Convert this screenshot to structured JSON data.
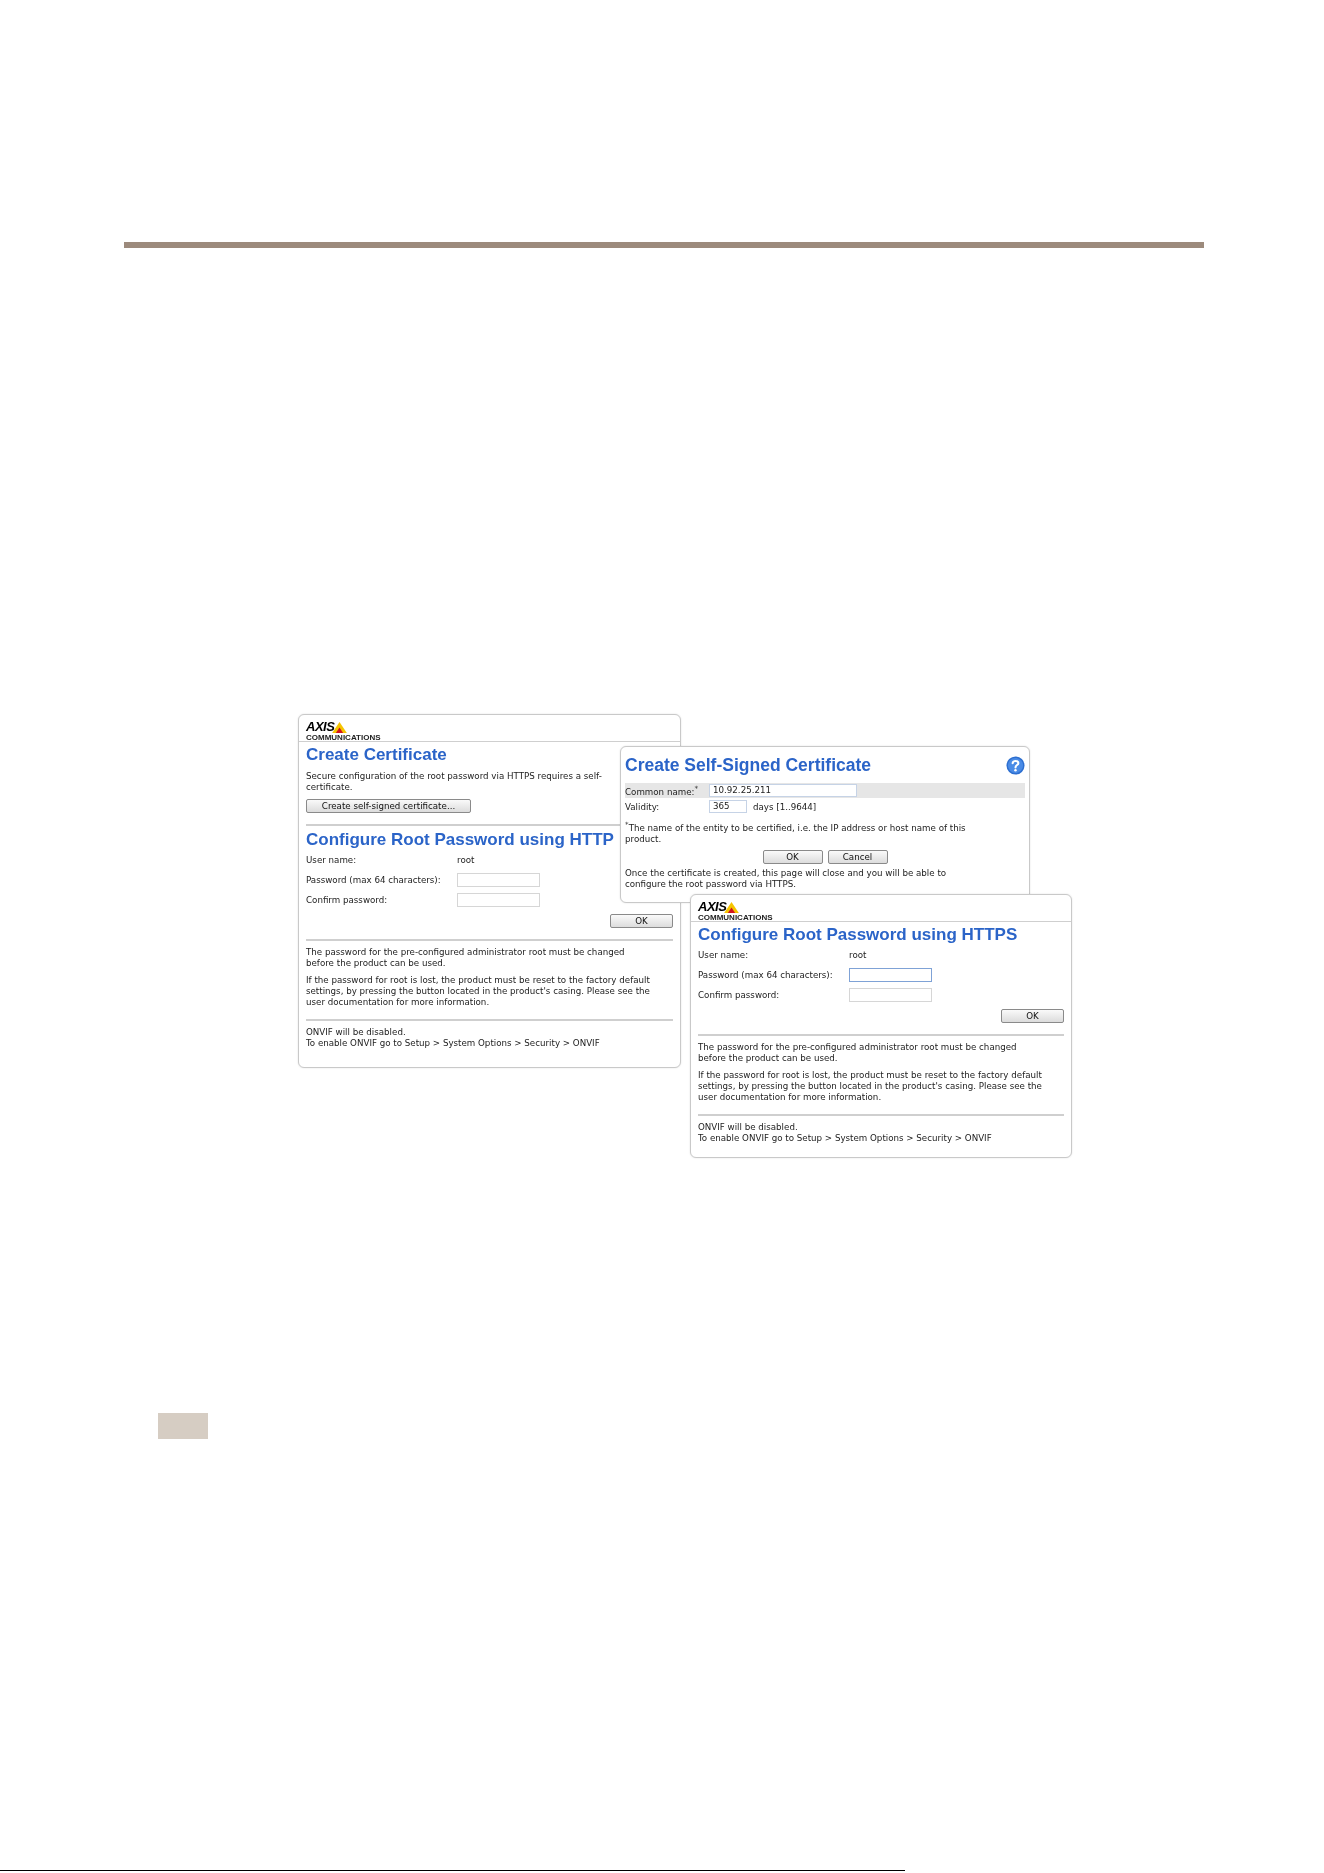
{
  "certificate_window": {
    "logo": {
      "name": "AXIS",
      "tagline": "COMMUNICATIONS"
    },
    "title": "Create Certificate",
    "description_lines": [
      "Secure configuration of the root password via HTTPS requires a self-",
      "certificate."
    ],
    "button": "Create self-signed certificate...",
    "password_section": {
      "title": "Configure Root Password using HTTP",
      "fields": [
        {
          "label": "User name:",
          "kind": "text",
          "value": "root"
        },
        {
          "label": "Password (max 64 characters):",
          "kind": "input",
          "focused": false
        },
        {
          "label": "Confirm password:",
          "kind": "input",
          "focused": false
        }
      ],
      "button": "OK",
      "notes": [
        [
          "The password for the pre-configured administrator root must be changed",
          "before the product can be used."
        ],
        [
          "If the password for root is lost, the product must be reset to the factory default",
          "settings, by pressing the button located in the product's casing. Please see the",
          "user documentation for more information."
        ]
      ],
      "onvif": [
        "ONVIF will be disabled.",
        "To enable ONVIF go to Setup > System Options > Security > ONVIF"
      ]
    }
  },
  "self_signed_dialog": {
    "title": "Create Self-Signed Certificate",
    "rows": [
      {
        "label": "Common name:",
        "required_mark": "*",
        "value": "10.92.25.211",
        "kind": "wide",
        "shaded": true
      },
      {
        "label": "Validity:",
        "value": "365",
        "kind": "short",
        "suffix": "days [1..9644]",
        "shaded": false
      }
    ],
    "footnote_mark": "*",
    "footnote_lines": [
      "The name of the entity to be certified, i.e. the IP address or host name of this",
      "product."
    ],
    "buttons": [
      "OK",
      "Cancel"
    ],
    "message_lines": [
      "Once the certificate is created, this page will close and you will be able to",
      "configure the root password via HTTPS."
    ]
  },
  "password_window": {
    "logo": {
      "name": "AXIS",
      "tagline": "COMMUNICATIONS"
    },
    "title": "Configure Root Password using HTTPS",
    "fields": [
      {
        "label": "User name:",
        "kind": "text",
        "value": "root"
      },
      {
        "label": "Password (max 64 characters):",
        "kind": "input",
        "focused": true
      },
      {
        "label": "Confirm password:",
        "kind": "input",
        "focused": false
      }
    ],
    "button": "OK",
    "notes": [
      [
        "The password for the pre-configured administrator root must be changed",
        "before the product can be used."
      ],
      [
        "If the password for root is lost, the product must be reset to the factory default",
        "settings, by pressing the button located in the product's casing. Please see the",
        "user documentation for more information."
      ]
    ],
    "onvif": [
      "ONVIF will be disabled.",
      "To enable ONVIF go to Setup > System Options > Security > ONVIF"
    ]
  }
}
